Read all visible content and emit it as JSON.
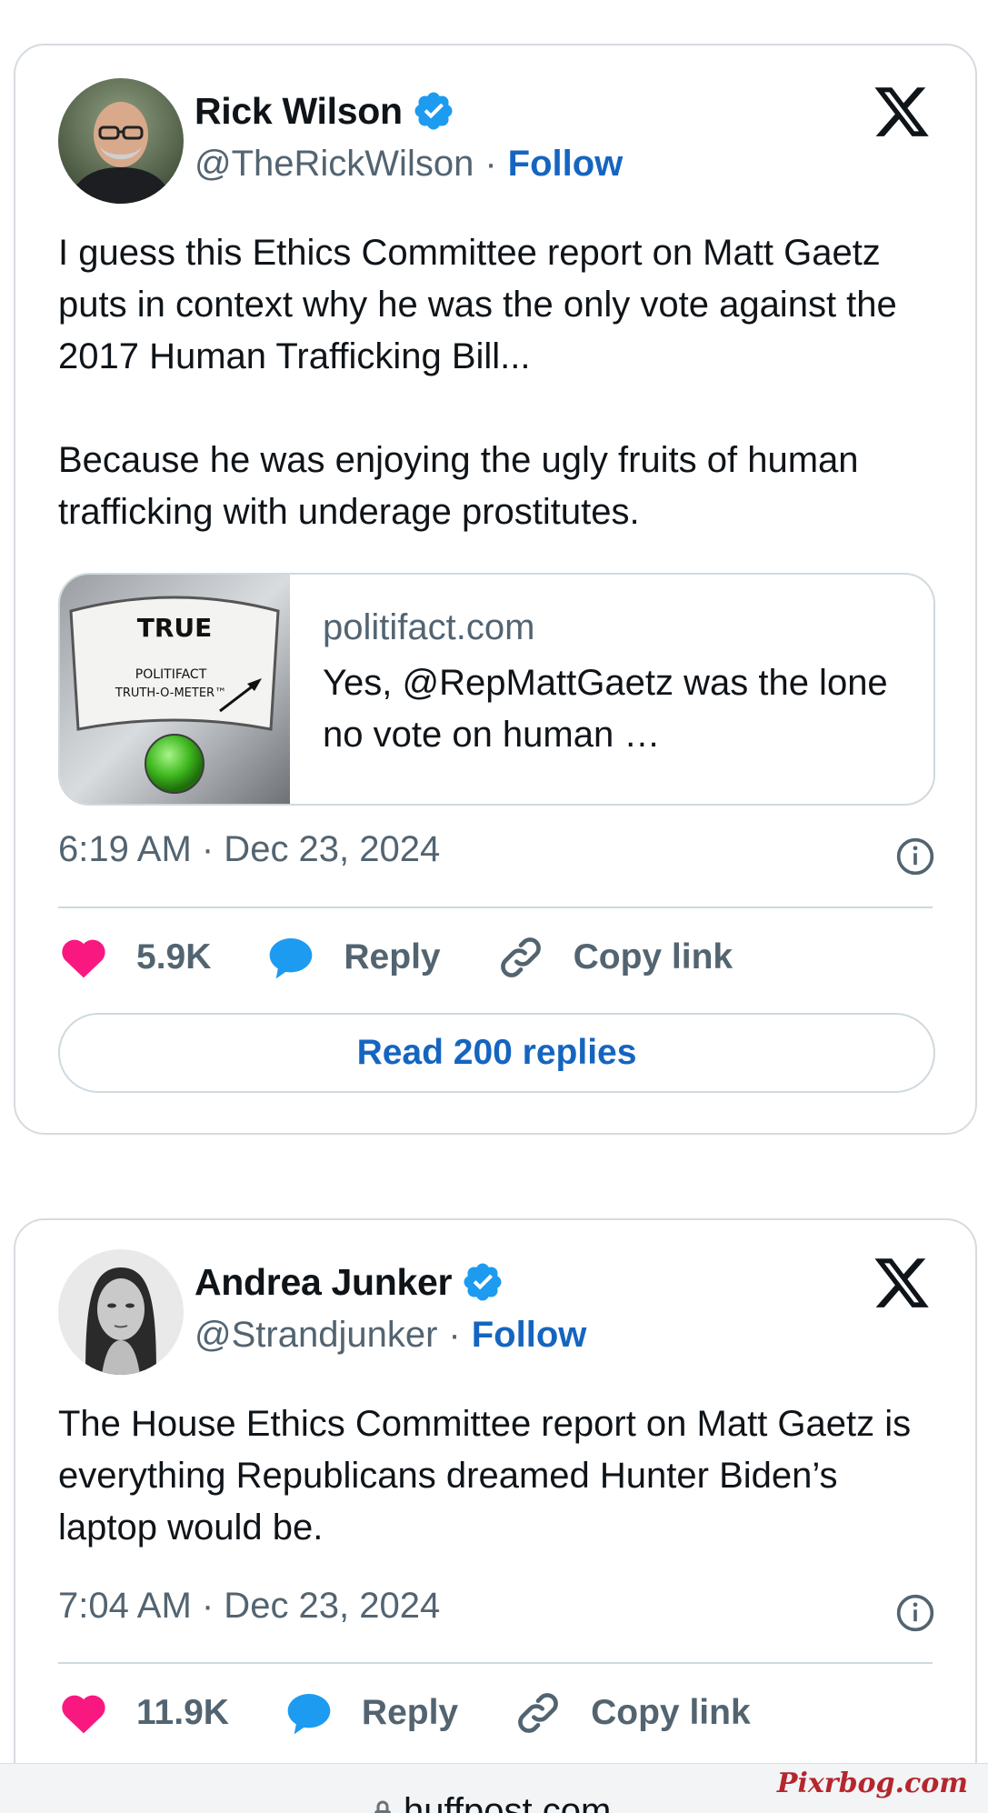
{
  "tweets": [
    {
      "author": {
        "name": "Rick Wilson",
        "handle": "@TheRickWilson",
        "separator": "·",
        "follow_label": "Follow"
      },
      "paragraphs": [
        "I guess this Ethics Committee report on Matt Gaetz puts in context why he was the only vote against the 2017 Human Trafficking Bill...",
        "Because he was enjoying the ugly fruits of human trafficking with underage prostitutes."
      ],
      "link_card": {
        "domain": "politifact.com",
        "title": "Yes, @RepMattGaetz was the lone no vote on human …",
        "thumb_rating": "TRUE",
        "thumb_line1": "POLITIFACT",
        "thumb_line2": "TRUTH-O-METER™"
      },
      "timestamp": "6:19 AM · Dec 23, 2024",
      "likes": "5.9K",
      "reply_label": "Reply",
      "copy_label": "Copy link",
      "read_replies_label": "Read 200 replies"
    },
    {
      "author": {
        "name": "Andrea Junker",
        "handle": "@Strandjunker",
        "separator": "·",
        "follow_label": "Follow"
      },
      "paragraphs": [
        "The House Ethics Committee report on Matt Gaetz is everything Republicans dreamed Hunter Biden’s laptop would be."
      ],
      "timestamp": "7:04 AM · Dec 23, 2024",
      "likes": "11.9K",
      "reply_label": "Reply",
      "copy_label": "Copy link"
    }
  ],
  "browser": {
    "url": "huffpost.com"
  },
  "watermark": "Pixrbog.com",
  "colors": {
    "like": "#f91880",
    "reply": "#1d9bf0",
    "follow": "#1565c0",
    "verified": "#1d9bf0"
  }
}
